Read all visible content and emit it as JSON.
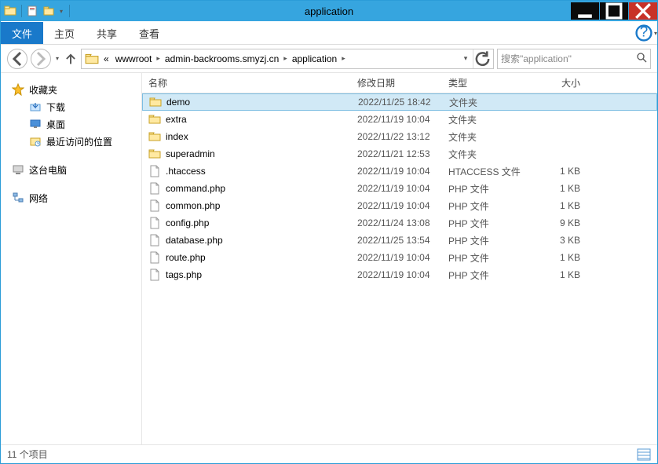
{
  "window": {
    "title": "application"
  },
  "ribbon": {
    "file_tab": "文件",
    "tabs": [
      "主页",
      "共享",
      "查看"
    ]
  },
  "breadcrumb": {
    "prefix": "«",
    "items": [
      "wwwroot",
      "admin-backrooms.smyzj.cn",
      "application"
    ]
  },
  "search": {
    "placeholder": "搜索\"application\""
  },
  "sidebar": {
    "favorites": {
      "header": "收藏夹",
      "items": [
        "下载",
        "桌面",
        "最近访问的位置"
      ]
    },
    "this_pc": "这台电脑",
    "network": "网络"
  },
  "columns": {
    "name": "名称",
    "date": "修改日期",
    "type": "类型",
    "size": "大小"
  },
  "files": [
    {
      "icon": "folder",
      "name": "demo",
      "date": "2022/11/25 18:42",
      "type": "文件夹",
      "size": "",
      "selected": true
    },
    {
      "icon": "folder",
      "name": "extra",
      "date": "2022/11/19 10:04",
      "type": "文件夹",
      "size": ""
    },
    {
      "icon": "folder",
      "name": "index",
      "date": "2022/11/22 13:12",
      "type": "文件夹",
      "size": ""
    },
    {
      "icon": "folder",
      "name": "superadmin",
      "date": "2022/11/21 12:53",
      "type": "文件夹",
      "size": ""
    },
    {
      "icon": "file",
      "name": ".htaccess",
      "date": "2022/11/19 10:04",
      "type": "HTACCESS 文件",
      "size": "1 KB"
    },
    {
      "icon": "file",
      "name": "command.php",
      "date": "2022/11/19 10:04",
      "type": "PHP 文件",
      "size": "1 KB"
    },
    {
      "icon": "file",
      "name": "common.php",
      "date": "2022/11/19 10:04",
      "type": "PHP 文件",
      "size": "1 KB"
    },
    {
      "icon": "file",
      "name": "config.php",
      "date": "2022/11/24 13:08",
      "type": "PHP 文件",
      "size": "9 KB"
    },
    {
      "icon": "file",
      "name": "database.php",
      "date": "2022/11/25 13:54",
      "type": "PHP 文件",
      "size": "3 KB"
    },
    {
      "icon": "file",
      "name": "route.php",
      "date": "2022/11/19 10:04",
      "type": "PHP 文件",
      "size": "1 KB"
    },
    {
      "icon": "file",
      "name": "tags.php",
      "date": "2022/11/19 10:04",
      "type": "PHP 文件",
      "size": "1 KB"
    }
  ],
  "status": {
    "count_text": "11 个项目"
  }
}
